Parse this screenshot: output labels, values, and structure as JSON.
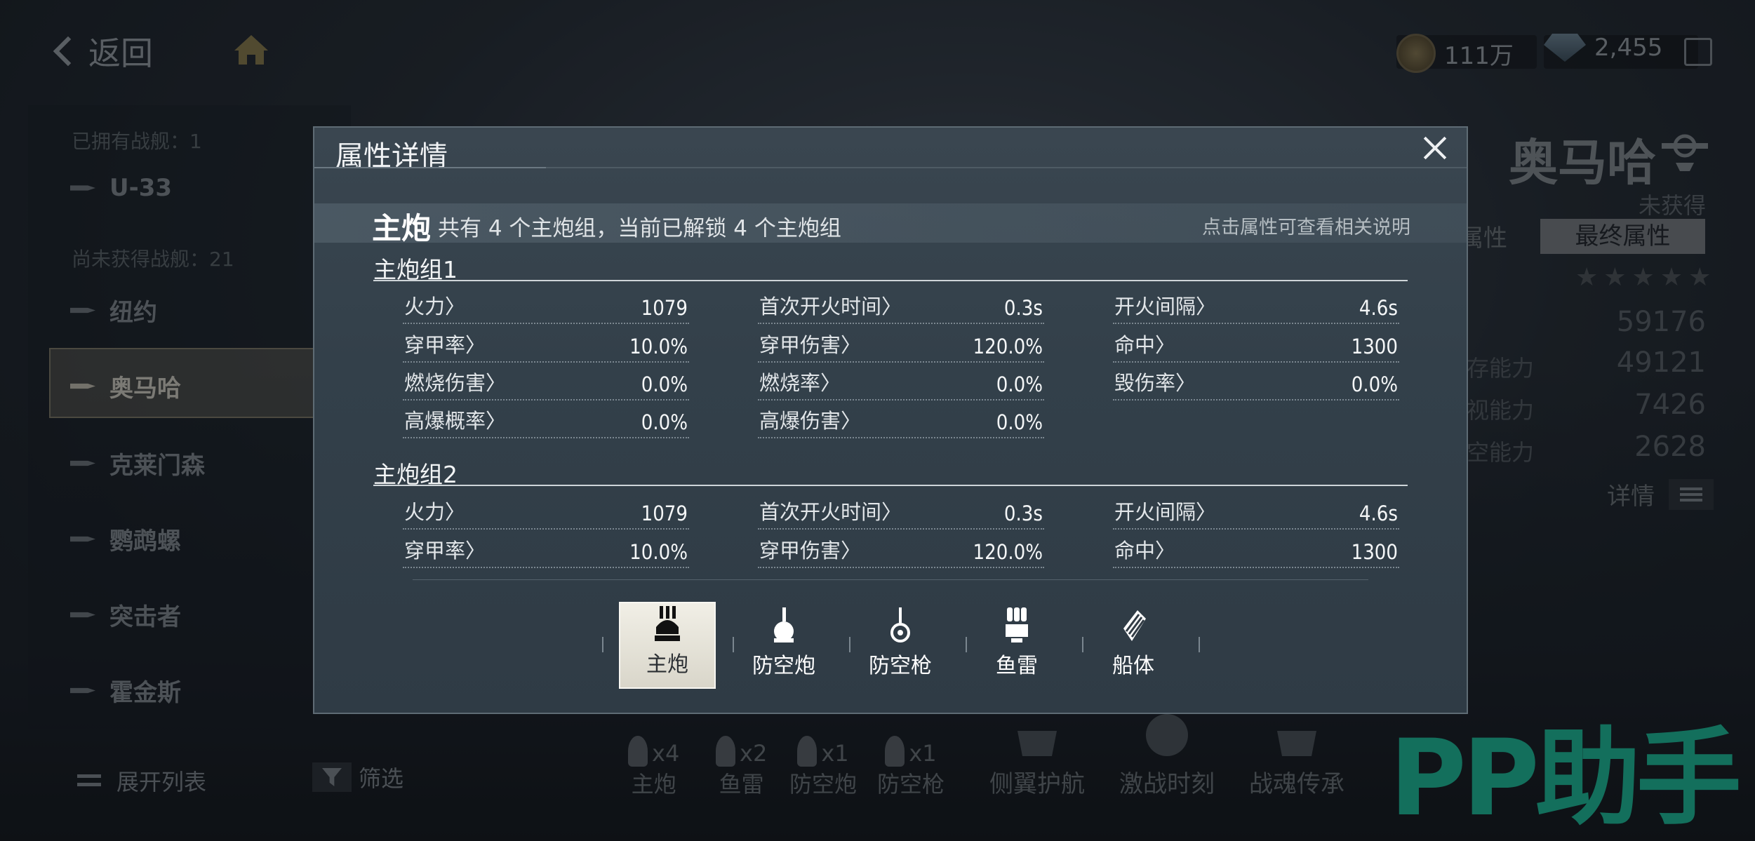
{
  "topbar": {
    "back_label": "返回",
    "coins": "111万",
    "gems": "2,455"
  },
  "left": {
    "owned_label": "已拥有战舰：1",
    "unowned_label": "尚未获得战舰：21",
    "ships": [
      {
        "name": "U-33"
      },
      {
        "name": "纽约"
      },
      {
        "name": "奥马哈"
      },
      {
        "name": "克莱门森"
      },
      {
        "name": "鹦鹉螺"
      },
      {
        "name": "突击者"
      },
      {
        "name": "霍金斯"
      }
    ],
    "expand_label": "展开列表",
    "filter_label": "筛选"
  },
  "right": {
    "ship_name": "奥马哈",
    "status": "未获得",
    "tab_base": "属性",
    "tab_final": "最终属性",
    "total": "59176",
    "stats": [
      {
        "label": "存能力",
        "value": "49121"
      },
      {
        "label": "视能力",
        "value": "7426"
      },
      {
        "label": "空能力",
        "value": "2628"
      }
    ],
    "detail_label": "详情"
  },
  "bottom": {
    "weapons": [
      {
        "label": "主炮",
        "count": "x4"
      },
      {
        "label": "鱼雷",
        "count": "x2"
      },
      {
        "label": "防空炮",
        "count": "x1"
      },
      {
        "label": "防空枪",
        "count": "x1"
      }
    ],
    "buttons": [
      {
        "label": "侧翼护航"
      },
      {
        "label": "激战时刻"
      },
      {
        "label": "战魂传承"
      }
    ],
    "watermark": "PP助手"
  },
  "modal": {
    "title": "属性详情",
    "section_title": "主炮",
    "section_desc": "共有 4 个主炮组，当前已解锁 4 个主炮组",
    "hint": "点击属性可查看相关说明",
    "groups": [
      {
        "title": "主炮组1",
        "attrs": [
          {
            "label": "火力〉",
            "value": "1079"
          },
          {
            "label": "首次开火时间〉",
            "value": "0.3s"
          },
          {
            "label": "开火间隔〉",
            "value": "4.6s"
          },
          {
            "label": "穿甲率〉",
            "value": "10.0%"
          },
          {
            "label": "穿甲伤害〉",
            "value": "120.0%"
          },
          {
            "label": "命中〉",
            "value": "1300"
          },
          {
            "label": "燃烧伤害〉",
            "value": "0.0%"
          },
          {
            "label": "燃烧率〉",
            "value": "0.0%"
          },
          {
            "label": "毁伤率〉",
            "value": "0.0%"
          },
          {
            "label": "高爆概率〉",
            "value": "0.0%"
          },
          {
            "label": "高爆伤害〉",
            "value": "0.0%"
          }
        ]
      },
      {
        "title": "主炮组2",
        "attrs": [
          {
            "label": "火力〉",
            "value": "1079"
          },
          {
            "label": "首次开火时间〉",
            "value": "0.3s"
          },
          {
            "label": "开火间隔〉",
            "value": "4.6s"
          },
          {
            "label": "穿甲率〉",
            "value": "10.0%"
          },
          {
            "label": "穿甲伤害〉",
            "value": "120.0%"
          },
          {
            "label": "命中〉",
            "value": "1300"
          }
        ]
      }
    ],
    "tabs": [
      {
        "label": "主炮",
        "icon": "main-gun-icon",
        "selected": true
      },
      {
        "label": "防空炮",
        "icon": "aa-gun-icon",
        "selected": false
      },
      {
        "label": "防空枪",
        "icon": "aa-mg-icon",
        "selected": false
      },
      {
        "label": "鱼雷",
        "icon": "torpedo-icon",
        "selected": false
      },
      {
        "label": "船体",
        "icon": "hull-icon",
        "selected": false
      }
    ]
  }
}
